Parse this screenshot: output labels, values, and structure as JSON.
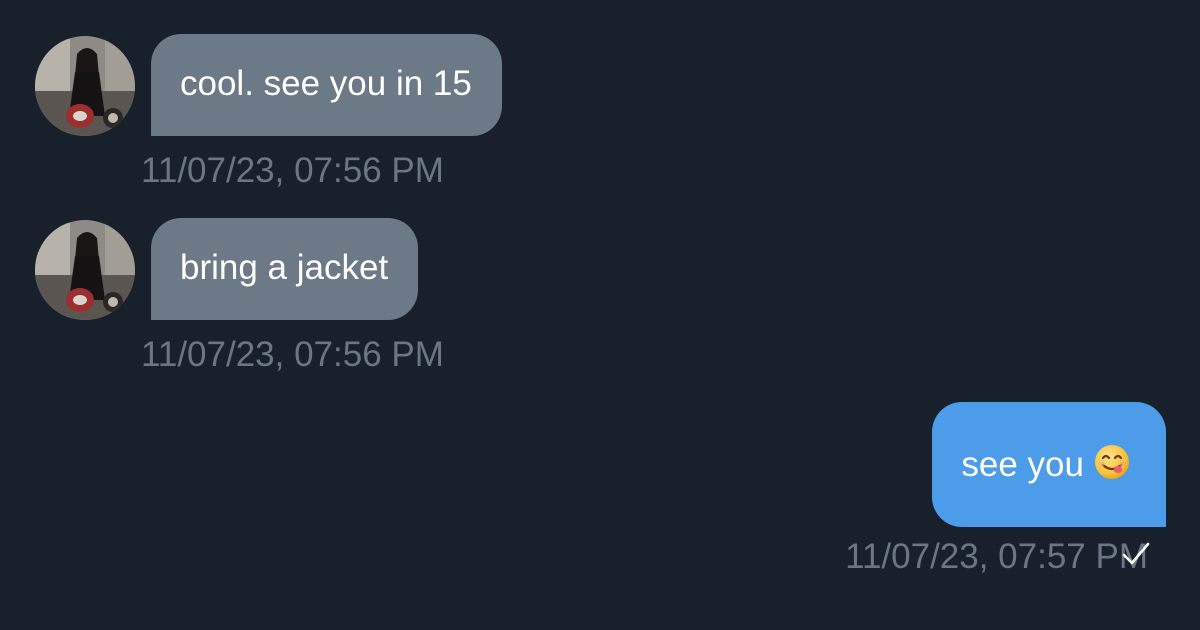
{
  "conversation": {
    "messages": [
      {
        "direction": "incoming",
        "text": "cool. see you in 15",
        "timestamp": "11/07/23, 07:56 PM",
        "avatar": "contact-avatar"
      },
      {
        "direction": "incoming",
        "text": "bring a jacket",
        "timestamp": "11/07/23, 07:56 PM",
        "avatar": "contact-avatar"
      },
      {
        "direction": "outgoing",
        "text": "see you",
        "emoji": "😋",
        "timestamp": "11/07/23, 07:57 PM",
        "status_icon": "checkmark-icon"
      }
    ]
  },
  "colors": {
    "background": "#18202b",
    "incoming_bubble": "#6b7a86",
    "outgoing_bubble": "#4c9ce9",
    "timestamp_text": "#6a7684",
    "message_text": "#ffffff"
  }
}
